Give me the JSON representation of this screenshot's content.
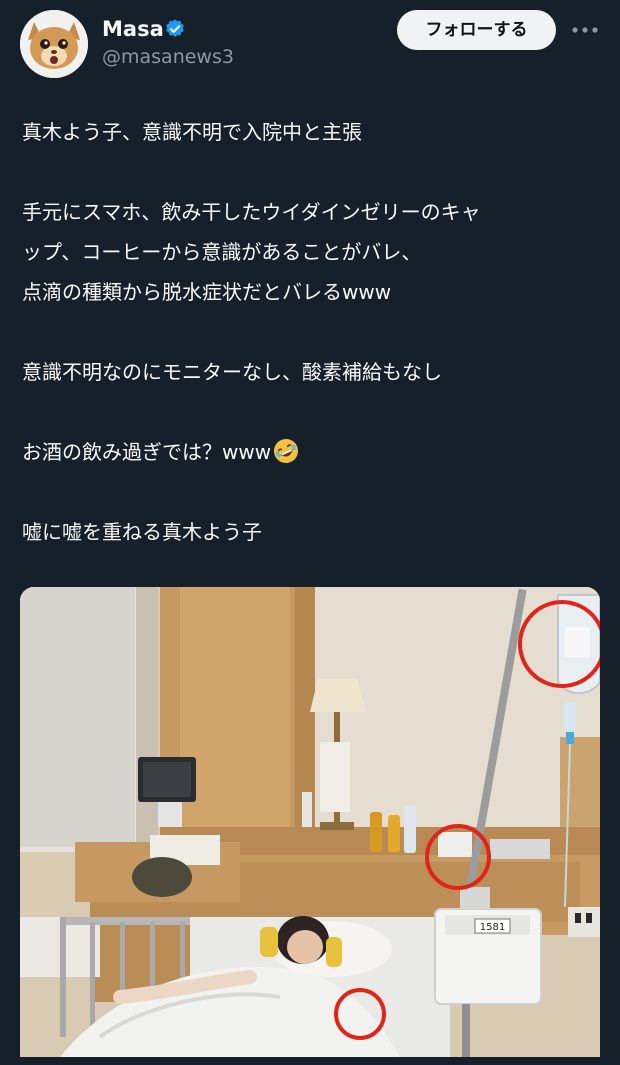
{
  "user": {
    "display_name": "Masa",
    "handle": "@masanews3",
    "verified": true,
    "avatar_icon": "cat-avatar-icon"
  },
  "header": {
    "follow_label": "フォローする",
    "more_icon": "more-horizontal-icon"
  },
  "tweet": {
    "lines": [
      "真木よう子、意識不明で入院中と主張",
      "",
      "手元にスマホ、飲み干したウイダインゼリーのキャ",
      "ップ、コーヒーから意識があることがバレ、",
      "点滴の種類から脱水症状だとバレるwww",
      "",
      "意識不明なのにモニターなし、酸素補給もなし",
      "",
      "お酒の飲み過ぎでは？www",
      "",
      "嘘に嘘を重ねる真木よう子"
    ],
    "emoji_icon": "rolling-laughing-emoji-icon"
  },
  "media": {
    "pump_label": "1581",
    "colors": {
      "background": "#15202b",
      "text": "#f7f9f9",
      "secondary_text": "#8b98a5",
      "verified": "#1d9bf0",
      "annotation_circle": "#e0241b"
    }
  }
}
